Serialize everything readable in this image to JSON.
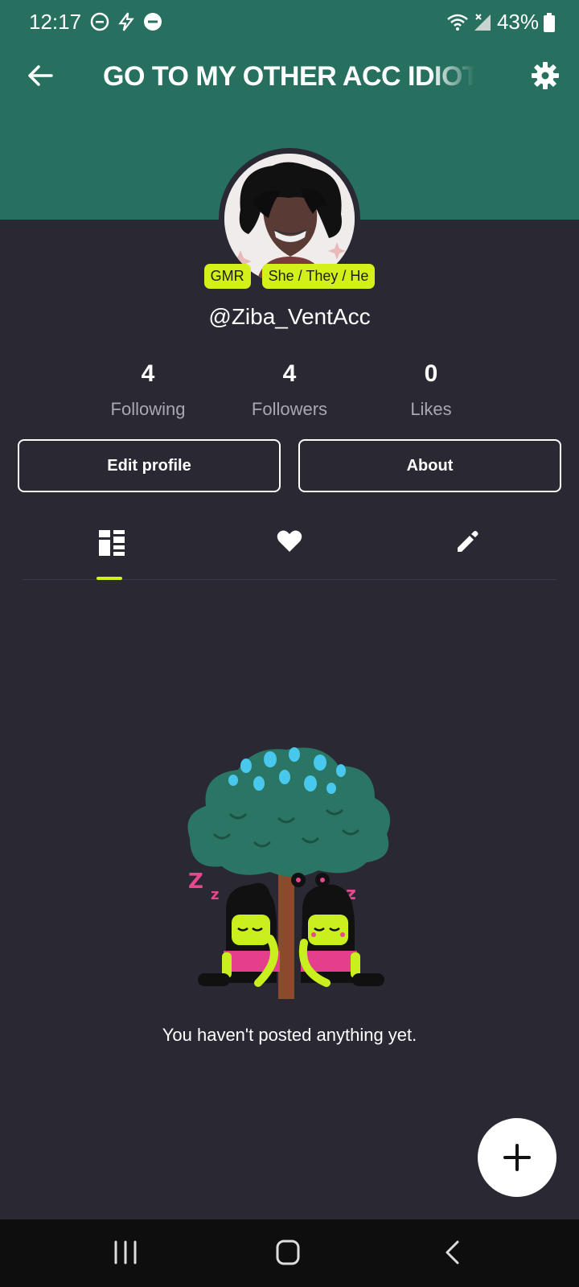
{
  "status_bar": {
    "time": "12:17",
    "battery": "43%"
  },
  "header": {
    "title": "GO TO MY OTHER ACC IDIOT"
  },
  "profile": {
    "badges": [
      "GMR",
      "She / They / He"
    ],
    "handle": "@Ziba_VentAcc",
    "stats": [
      {
        "value": "4",
        "label": "Following"
      },
      {
        "value": "4",
        "label": "Followers"
      },
      {
        "value": "0",
        "label": "Likes"
      }
    ],
    "edit_label": "Edit profile",
    "about_label": "About"
  },
  "tabs": [
    {
      "icon": "grid-icon"
    },
    {
      "icon": "heart-icon"
    },
    {
      "icon": "pencil-icon"
    }
  ],
  "empty_state": {
    "message": "You haven't posted anything yet."
  },
  "colors": {
    "header": "#27705f",
    "background": "#2a2833",
    "accent": "#d4f01a"
  }
}
